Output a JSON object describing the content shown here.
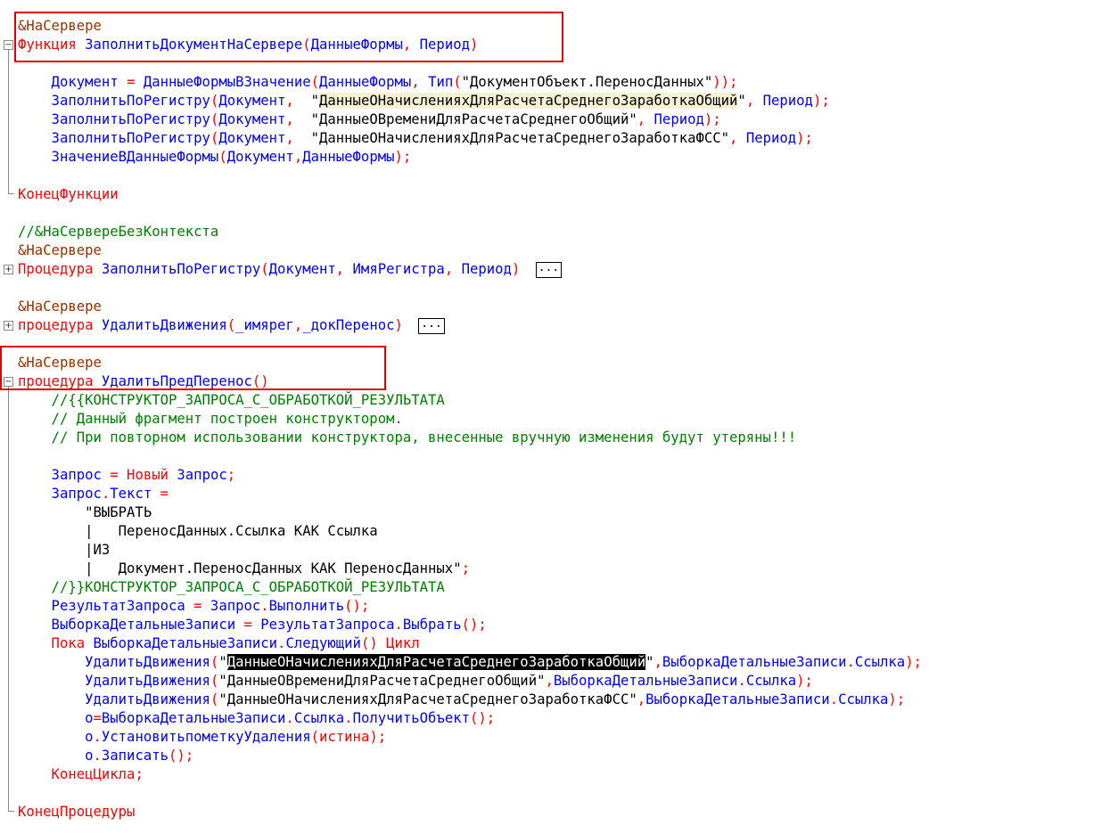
{
  "code": {
    "lines": [
      {
        "tokens": [
          {
            "t": "&НаСервере",
            "c": "pp"
          }
        ]
      },
      {
        "tokens": [
          {
            "t": "Функция",
            "c": "kw"
          },
          {
            "t": " ЗаполнитьДокументНаСервере",
            "c": "id"
          },
          {
            "t": "(",
            "c": "op"
          },
          {
            "t": "ДанныеФормы",
            "c": "id"
          },
          {
            "t": ", ",
            "c": "op"
          },
          {
            "t": "Период",
            "c": "id"
          },
          {
            "t": ")",
            "c": "op"
          }
        ]
      },
      {
        "tokens": []
      },
      {
        "tokens": [
          {
            "t": "    Документ ",
            "c": "id"
          },
          {
            "t": "=",
            "c": "op"
          },
          {
            "t": " ДанныеФормыВЗначение",
            "c": "id"
          },
          {
            "t": "(",
            "c": "op"
          },
          {
            "t": "ДанныеФормы",
            "c": "id"
          },
          {
            "t": ", ",
            "c": "op"
          },
          {
            "t": "Тип",
            "c": "id"
          },
          {
            "t": "(",
            "c": "op"
          },
          {
            "t": "\"ДокументОбъект.ПереносДанных\"",
            "c": "st"
          },
          {
            "t": "));",
            "c": "op"
          }
        ]
      },
      {
        "tokens": [
          {
            "t": "    ЗаполнитьПоРегистру",
            "c": "id"
          },
          {
            "t": "(",
            "c": "op"
          },
          {
            "t": "Документ",
            "c": "id"
          },
          {
            "t": ",  ",
            "c": "op"
          },
          {
            "t": "\"",
            "c": "st"
          },
          {
            "t": "ДанныеОНачисленияхДляРасчетаСреднегоЗаработкаОбщий",
            "c": "st hl"
          },
          {
            "t": "\"",
            "c": "st"
          },
          {
            "t": ", ",
            "c": "op"
          },
          {
            "t": "Период",
            "c": "id"
          },
          {
            "t": ");",
            "c": "op"
          }
        ]
      },
      {
        "tokens": [
          {
            "t": "    ЗаполнитьПоРегистру",
            "c": "id"
          },
          {
            "t": "(",
            "c": "op"
          },
          {
            "t": "Документ",
            "c": "id"
          },
          {
            "t": ",  ",
            "c": "op"
          },
          {
            "t": "\"ДанныеОВремениДляРасчетаСреднегоОбщий\"",
            "c": "st"
          },
          {
            "t": ", ",
            "c": "op"
          },
          {
            "t": "Период",
            "c": "id"
          },
          {
            "t": ");",
            "c": "op"
          }
        ]
      },
      {
        "tokens": [
          {
            "t": "    ЗаполнитьПоРегистру",
            "c": "id"
          },
          {
            "t": "(",
            "c": "op"
          },
          {
            "t": "Документ",
            "c": "id"
          },
          {
            "t": ",  ",
            "c": "op"
          },
          {
            "t": "\"ДанныеОНачисленияхДляРасчетаСреднегоЗаработкаФСС\"",
            "c": "st"
          },
          {
            "t": ", ",
            "c": "op"
          },
          {
            "t": "Период",
            "c": "id"
          },
          {
            "t": ");",
            "c": "op"
          }
        ]
      },
      {
        "tokens": [
          {
            "t": "    ЗначениеВДанныеФормы",
            "c": "id"
          },
          {
            "t": "(",
            "c": "op"
          },
          {
            "t": "Документ",
            "c": "id"
          },
          {
            "t": ",",
            "c": "op"
          },
          {
            "t": "ДанныеФормы",
            "c": "id"
          },
          {
            "t": ");",
            "c": "op"
          }
        ]
      },
      {
        "tokens": []
      },
      {
        "tokens": [
          {
            "t": "КонецФункции",
            "c": "kw"
          }
        ]
      },
      {
        "tokens": []
      },
      {
        "tokens": [
          {
            "t": "//&НаСервереБезКонтекста",
            "c": "cm"
          }
        ]
      },
      {
        "tokens": [
          {
            "t": "&НаСервере",
            "c": "pp"
          }
        ]
      },
      {
        "tokens": [
          {
            "t": "Процедура",
            "c": "kw"
          },
          {
            "t": " ЗаполнитьПоРегистру",
            "c": "id"
          },
          {
            "t": "(",
            "c": "op"
          },
          {
            "t": "Документ",
            "c": "id"
          },
          {
            "t": ", ",
            "c": "op"
          },
          {
            "t": "ИмяРегистра",
            "c": "id"
          },
          {
            "t": ", ",
            "c": "op"
          },
          {
            "t": "Период",
            "c": "id"
          },
          {
            "t": ") ",
            "c": "op"
          }
        ],
        "collapsed": "..."
      },
      {
        "tokens": []
      },
      {
        "tokens": [
          {
            "t": "&НаСервере",
            "c": "pp"
          }
        ]
      },
      {
        "tokens": [
          {
            "t": "процедура",
            "c": "kw"
          },
          {
            "t": " УдалитьДвижения",
            "c": "id"
          },
          {
            "t": "(",
            "c": "op"
          },
          {
            "t": "_имярег",
            "c": "id"
          },
          {
            "t": ",",
            "c": "op"
          },
          {
            "t": "_докПеренос",
            "c": "id"
          },
          {
            "t": ") ",
            "c": "op"
          }
        ],
        "collapsed": "..."
      },
      {
        "tokens": []
      },
      {
        "tokens": [
          {
            "t": "&НаСервере",
            "c": "pp"
          }
        ]
      },
      {
        "tokens": [
          {
            "t": "процедура",
            "c": "kw"
          },
          {
            "t": " УдалитьПредПеренос",
            "c": "id"
          },
          {
            "t": "()",
            "c": "op"
          }
        ]
      },
      {
        "tokens": [
          {
            "t": "    //{{КОНСТРУКТОР_ЗАПРОСА_С_ОБРАБОТКОЙ_РЕЗУЛЬТАТА",
            "c": "cm"
          }
        ]
      },
      {
        "tokens": [
          {
            "t": "    // Данный фрагмент построен конструктором.",
            "c": "cm"
          }
        ]
      },
      {
        "tokens": [
          {
            "t": "    // При повторном использовании конструктора, внесенные вручную изменения будут утеряны!!!",
            "c": "cm"
          }
        ]
      },
      {
        "tokens": []
      },
      {
        "tokens": [
          {
            "t": "    Запрос ",
            "c": "id"
          },
          {
            "t": "=",
            "c": "op"
          },
          {
            "t": " Новый",
            "c": "kw"
          },
          {
            "t": " Запрос",
            "c": "id"
          },
          {
            "t": ";",
            "c": "op"
          }
        ]
      },
      {
        "tokens": [
          {
            "t": "    Запрос",
            "c": "id"
          },
          {
            "t": ".",
            "c": "op"
          },
          {
            "t": "Текст ",
            "c": "id"
          },
          {
            "t": "=",
            "c": "op"
          }
        ]
      },
      {
        "tokens": [
          {
            "t": "        \"ВЫБРАТЬ",
            "c": "st"
          }
        ]
      },
      {
        "tokens": [
          {
            "t": "        |   ПереносДанных.Ссылка КАК Ссылка",
            "c": "st"
          }
        ]
      },
      {
        "tokens": [
          {
            "t": "        |ИЗ",
            "c": "st"
          }
        ]
      },
      {
        "tokens": [
          {
            "t": "        |   Документ.ПереносДанных КАК ПереносДанных\"",
            "c": "st"
          },
          {
            "t": ";",
            "c": "op"
          }
        ]
      },
      {
        "tokens": [
          {
            "t": "    //}}КОНСТРУКТОР_ЗАПРОСА_С_ОБРАБОТКОЙ_РЕЗУЛЬТАТА",
            "c": "cm"
          }
        ]
      },
      {
        "tokens": [
          {
            "t": "    РезультатЗапроса ",
            "c": "id"
          },
          {
            "t": "=",
            "c": "op"
          },
          {
            "t": " Запрос",
            "c": "id"
          },
          {
            "t": ".",
            "c": "op"
          },
          {
            "t": "Выполнить",
            "c": "id"
          },
          {
            "t": "();",
            "c": "op"
          }
        ]
      },
      {
        "tokens": [
          {
            "t": "    ВыборкаДетальныеЗаписи ",
            "c": "id"
          },
          {
            "t": "=",
            "c": "op"
          },
          {
            "t": " РезультатЗапроса",
            "c": "id"
          },
          {
            "t": ".",
            "c": "op"
          },
          {
            "t": "Выбрать",
            "c": "id"
          },
          {
            "t": "();",
            "c": "op"
          }
        ]
      },
      {
        "tokens": [
          {
            "t": "    Пока",
            "c": "kw"
          },
          {
            "t": " ВыборкаДетальныеЗаписи",
            "c": "id"
          },
          {
            "t": ".",
            "c": "op"
          },
          {
            "t": "Следующий",
            "c": "id"
          },
          {
            "t": "()",
            "c": "op"
          },
          {
            "t": " Цикл",
            "c": "kw"
          }
        ]
      },
      {
        "tokens": [
          {
            "t": "        УдалитьДвижения",
            "c": "id"
          },
          {
            "t": "(",
            "c": "op"
          },
          {
            "t": "\"",
            "c": "st"
          },
          {
            "t": "ДанныеОНачисленияхДляРасчетаСреднегоЗаработкаОбщий",
            "c": "st sel"
          },
          {
            "t": "\"",
            "c": "st"
          },
          {
            "t": ",",
            "c": "op"
          },
          {
            "t": "ВыборкаДетальныеЗаписи",
            "c": "id"
          },
          {
            "t": ".",
            "c": "op"
          },
          {
            "t": "Ссылка",
            "c": "id"
          },
          {
            "t": ");",
            "c": "op"
          }
        ]
      },
      {
        "tokens": [
          {
            "t": "        УдалитьДвижения",
            "c": "id"
          },
          {
            "t": "(",
            "c": "op"
          },
          {
            "t": "\"ДанныеОВремениДляРасчетаСреднегоОбщий\"",
            "c": "st"
          },
          {
            "t": ",",
            "c": "op"
          },
          {
            "t": "ВыборкаДетальныеЗаписи",
            "c": "id"
          },
          {
            "t": ".",
            "c": "op"
          },
          {
            "t": "Ссылка",
            "c": "id"
          },
          {
            "t": ");",
            "c": "op"
          }
        ]
      },
      {
        "tokens": [
          {
            "t": "        УдалитьДвижения",
            "c": "id"
          },
          {
            "t": "(",
            "c": "op"
          },
          {
            "t": "\"ДанныеОНачисленияхДляРасчетаСреднегоЗаработкаФСС\"",
            "c": "st"
          },
          {
            "t": ",",
            "c": "op"
          },
          {
            "t": "ВыборкаДетальныеЗаписи",
            "c": "id"
          },
          {
            "t": ".",
            "c": "op"
          },
          {
            "t": "Ссылка",
            "c": "id"
          },
          {
            "t": ");",
            "c": "op"
          }
        ]
      },
      {
        "tokens": [
          {
            "t": "        о",
            "c": "id"
          },
          {
            "t": "=",
            "c": "op"
          },
          {
            "t": "ВыборкаДетальныеЗаписи",
            "c": "id"
          },
          {
            "t": ".",
            "c": "op"
          },
          {
            "t": "Ссылка",
            "c": "id"
          },
          {
            "t": ".",
            "c": "op"
          },
          {
            "t": "ПолучитьОбъект",
            "c": "id"
          },
          {
            "t": "();",
            "c": "op"
          }
        ]
      },
      {
        "tokens": [
          {
            "t": "        о",
            "c": "id"
          },
          {
            "t": ".",
            "c": "op"
          },
          {
            "t": "УстановитьпометкуУдаления",
            "c": "id"
          },
          {
            "t": "(",
            "c": "op"
          },
          {
            "t": "истина",
            "c": "kw"
          },
          {
            "t": ");",
            "c": "op"
          }
        ]
      },
      {
        "tokens": [
          {
            "t": "        о",
            "c": "id"
          },
          {
            "t": ".",
            "c": "op"
          },
          {
            "t": "Записать",
            "c": "id"
          },
          {
            "t": "();",
            "c": "op"
          }
        ]
      },
      {
        "tokens": [
          {
            "t": "    КонецЦикла",
            "c": "kw"
          },
          {
            "t": ";",
            "c": "op"
          }
        ]
      },
      {
        "tokens": []
      },
      {
        "tokens": [
          {
            "t": "КонецПроцедуры",
            "c": "kw"
          }
        ]
      }
    ],
    "fold_markers": [
      {
        "line": 1,
        "symbol": "⊟",
        "name": "fold-collapse-icon"
      },
      {
        "line": 13,
        "symbol": "⊞",
        "name": "fold-expand-icon"
      },
      {
        "line": 16,
        "symbol": "⊞",
        "name": "fold-expand-icon"
      },
      {
        "line": 19,
        "symbol": "⊟",
        "name": "fold-collapse-icon"
      }
    ]
  },
  "colors": {
    "keyword": "#ff0000",
    "identifier": "#0000ff",
    "comment": "#008000",
    "string": "#000000",
    "preprocessor": "#963200",
    "annotation_box": "#e00000"
  }
}
